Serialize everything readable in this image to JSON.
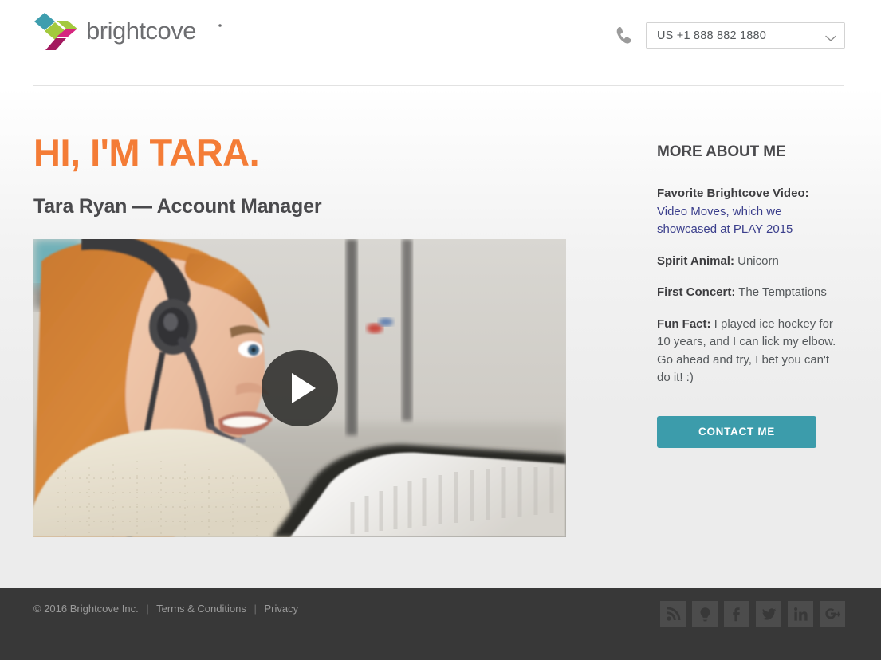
{
  "header": {
    "logo_alt": "brightcove",
    "logo_wordmark": "brightcove",
    "phone_icon": "phone-handset-icon",
    "phone_select": {
      "value": "US +1 888 882 1880",
      "chevron_icon": "chevron-down-icon"
    }
  },
  "hero": {
    "title": "HI, I'M TARA.",
    "subtitle": "Tara Ryan — Account Manager",
    "video": {
      "play_icon": "play-triangle-icon",
      "poster_alt": "Woman with red hair wearing a phone headset smiling at an office desk"
    }
  },
  "sidebar": {
    "title": "MORE ABOUT ME",
    "facts": [
      {
        "label": "Favorite Brightcove Video:",
        "link_text": "Video Moves, which we showcased at PLAY 2015",
        "value": ""
      },
      {
        "label": "Spirit Animal:",
        "value": " Unicorn"
      },
      {
        "label": "First Concert:",
        "value": " The Temptations"
      },
      {
        "label": "Fun Fact:",
        "value": " I played ice hockey for 10 years, and I can lick my elbow. Go ahead and try, I bet you can't do it! :)"
      }
    ],
    "contact_button": "CONTACT ME"
  },
  "footer": {
    "copyright": "© 2016 Brightcove Inc.",
    "sep1": "|",
    "terms": "Terms & Conditions",
    "sep2": "|",
    "privacy": "Privacy",
    "social": [
      {
        "name": "rss-icon"
      },
      {
        "name": "lightbulb-icon"
      },
      {
        "name": "facebook-icon"
      },
      {
        "name": "twitter-icon"
      },
      {
        "name": "linkedin-icon"
      },
      {
        "name": "googleplus-icon"
      }
    ]
  },
  "colors": {
    "accent_orange": "#f47c36",
    "teal_button": "#3c9cab",
    "link_navy": "#3b3f8c",
    "footer_bg": "#383838"
  }
}
